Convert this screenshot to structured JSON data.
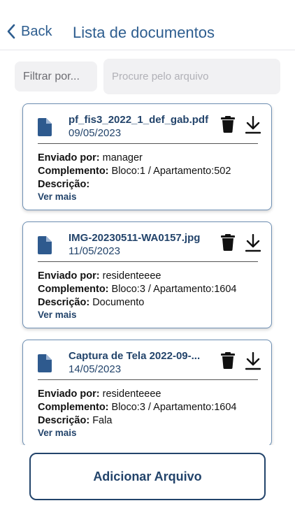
{
  "header": {
    "back_label": "Back",
    "title": "Lista de documentos"
  },
  "filters": {
    "filter_label": "Filtrar por...",
    "search_placeholder": "Procure pelo arquivo"
  },
  "labels": {
    "sender": "Enviado por:",
    "complement": "Complemento:",
    "description": "Descrição:",
    "see_more": "Ver mais"
  },
  "documents": [
    {
      "filename": "pf_fis3_2022_1_def_gab.pdf",
      "date": "09/05/2023",
      "sender": "manager",
      "complement": "Bloco:1 / Apartamento:502",
      "description": ""
    },
    {
      "filename": "IMG-20230511-WA0157.jpg",
      "date": "11/05/2023",
      "sender": "residenteeee",
      "complement": "Bloco:3 / Apartamento:1604",
      "description": "Documento"
    },
    {
      "filename": "Captura de Tela 2022-09-...",
      "date": "14/05/2023",
      "sender": "residenteeee",
      "complement": "Bloco:3 / Apartamento:1604",
      "description": "Fala"
    }
  ],
  "footer": {
    "add_button": "Adicionar Arquivo"
  },
  "colors": {
    "accent": "#23446b",
    "header_blue": "#2d5d8f",
    "icon_blue": "#2e5a8e",
    "input_bg": "#f1f1f3"
  },
  "icons": {
    "back": "chevron-left-icon",
    "file": "document-file-icon",
    "trash": "trash-icon",
    "download": "download-icon"
  }
}
